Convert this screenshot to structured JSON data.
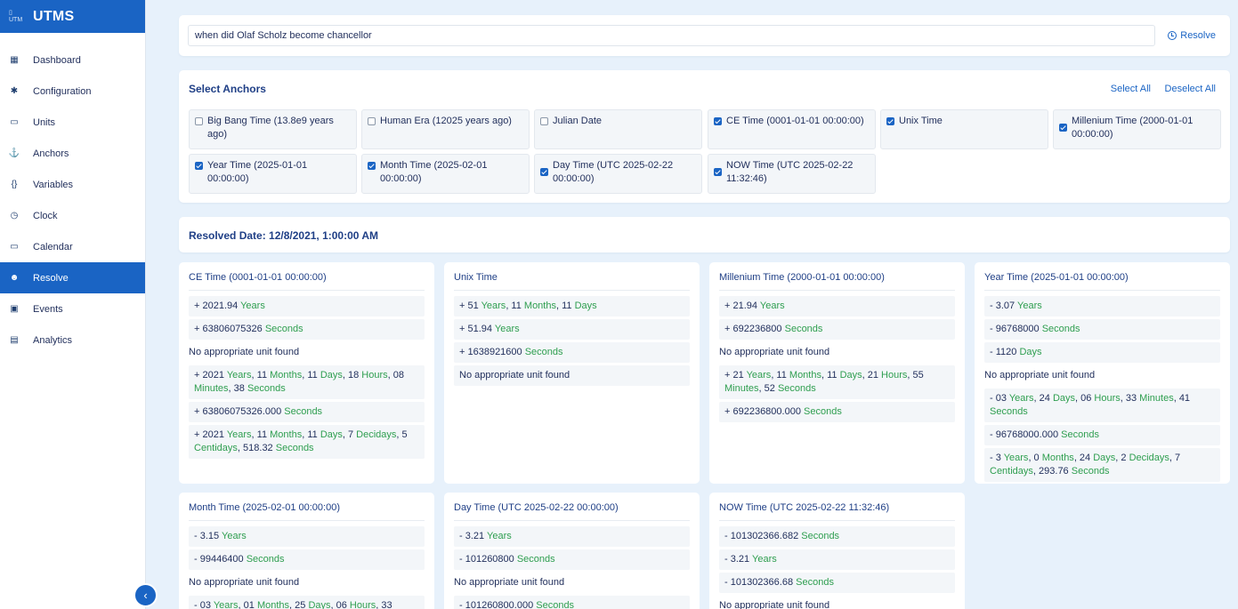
{
  "app": {
    "logo_text": "UTM",
    "title": "UTMS"
  },
  "sidebar": {
    "items": [
      {
        "label": "Dashboard",
        "icon": "dashboard-icon",
        "glyph": "▦",
        "active": false
      },
      {
        "label": "Configuration",
        "icon": "gear-icon",
        "glyph": "✱",
        "active": false
      },
      {
        "label": "Units",
        "icon": "ruler-icon",
        "glyph": "▭",
        "active": false
      },
      {
        "label": "Anchors",
        "icon": "anchor-icon",
        "glyph": "⚓",
        "active": false
      },
      {
        "label": "Variables",
        "icon": "braces-icon",
        "glyph": "{}",
        "active": false
      },
      {
        "label": "Clock",
        "icon": "clock-icon",
        "glyph": "◷",
        "active": false
      },
      {
        "label": "Calendar",
        "icon": "calendar-icon",
        "glyph": "▭",
        "active": false
      },
      {
        "label": "Resolve",
        "icon": "robot-icon",
        "glyph": "☻",
        "active": true
      },
      {
        "label": "Events",
        "icon": "event-icon",
        "glyph": "▣",
        "active": false
      },
      {
        "label": "Analytics",
        "icon": "analytics-icon",
        "glyph": "▤",
        "active": false
      }
    ],
    "collapse_glyph": "‹"
  },
  "search": {
    "value": "when did Olaf Scholz become chancellor",
    "resolve_label": "Resolve"
  },
  "anchors": {
    "title": "Select Anchors",
    "select_all": "Select All",
    "deselect_all": "Deselect All",
    "items": [
      {
        "label": "Big Bang Time (13.8e9 years ago)",
        "checked": false
      },
      {
        "label": "Human Era (12025 years ago)",
        "checked": false
      },
      {
        "label": "Julian Date",
        "checked": false
      },
      {
        "label": "CE Time (0001-01-01 00:00:00)",
        "checked": true
      },
      {
        "label": "Unix Time",
        "checked": true
      },
      {
        "label": "Millenium Time (2000-01-01 00:00:00)",
        "checked": true
      },
      {
        "label": "Year Time (2025-01-01 00:00:00)",
        "checked": true
      },
      {
        "label": "Month Time (2025-02-01 00:00:00)",
        "checked": true
      },
      {
        "label": "Day Time (UTC 2025-02-22 00:00:00)",
        "checked": true
      },
      {
        "label": "NOW Time (UTC 2025-02-22 11:32:46)",
        "checked": true
      }
    ]
  },
  "resolved": {
    "title": "Resolved Date: 12/8/2021, 1:00:00 AM"
  },
  "results": [
    {
      "title": "CE Time (0001-01-01 00:00:00)",
      "rows": [
        [
          [
            "+ 2021.94 ",
            "t"
          ],
          [
            "Years",
            "u"
          ]
        ],
        [
          [
            "+ 63806075326 ",
            "t"
          ],
          [
            "Seconds",
            "u"
          ]
        ],
        [
          [
            "No appropriate unit found",
            "p"
          ]
        ],
        [
          [
            "+ 2021 ",
            "t"
          ],
          [
            "Years",
            "u"
          ],
          [
            ", 11 ",
            "t"
          ],
          [
            "Months",
            "u"
          ],
          [
            ", 11 ",
            "t"
          ],
          [
            "Days",
            "u"
          ],
          [
            ", 18 ",
            "t"
          ],
          [
            "Hours",
            "u"
          ],
          [
            ", 08 ",
            "t"
          ],
          [
            "Minutes",
            "u"
          ],
          [
            ", 38 ",
            "t"
          ],
          [
            "Seconds",
            "u"
          ]
        ],
        [
          [
            "+ 63806075326.000 ",
            "t"
          ],
          [
            "Seconds",
            "u"
          ]
        ],
        [
          [
            "+ 2021 ",
            "t"
          ],
          [
            "Years",
            "u"
          ],
          [
            ", 11 ",
            "t"
          ],
          [
            "Months",
            "u"
          ],
          [
            ", 11 ",
            "t"
          ],
          [
            "Days",
            "u"
          ],
          [
            ", 7 ",
            "t"
          ],
          [
            "Decidays",
            "u"
          ],
          [
            ", 5 ",
            "t"
          ],
          [
            "Centidays",
            "u"
          ],
          [
            ", 518.32 ",
            "t"
          ],
          [
            "Seconds",
            "u"
          ]
        ]
      ]
    },
    {
      "title": "Unix Time",
      "rows": [
        [
          [
            "+ 51 ",
            "t"
          ],
          [
            "Years",
            "u"
          ],
          [
            ", 11 ",
            "t"
          ],
          [
            "Months",
            "u"
          ],
          [
            ", 11 ",
            "t"
          ],
          [
            "Days",
            "u"
          ]
        ],
        [
          [
            "+ 51.94 ",
            "t"
          ],
          [
            "Years",
            "u"
          ]
        ],
        [
          [
            "+ 1638921600 ",
            "t"
          ],
          [
            "Seconds",
            "u"
          ]
        ],
        [
          [
            "No appropriate unit found",
            "t"
          ]
        ]
      ]
    },
    {
      "title": "Millenium Time (2000-01-01 00:00:00)",
      "rows": [
        [
          [
            "+ 21.94 ",
            "t"
          ],
          [
            "Years",
            "u"
          ]
        ],
        [
          [
            "+ 692236800 ",
            "t"
          ],
          [
            "Seconds",
            "u"
          ]
        ],
        [
          [
            "No appropriate unit found",
            "p"
          ]
        ],
        [
          [
            "+ 21 ",
            "t"
          ],
          [
            "Years",
            "u"
          ],
          [
            ", 11 ",
            "t"
          ],
          [
            "Months",
            "u"
          ],
          [
            ", 11 ",
            "t"
          ],
          [
            "Days",
            "u"
          ],
          [
            ", 21 ",
            "t"
          ],
          [
            "Hours",
            "u"
          ],
          [
            ", 55 ",
            "t"
          ],
          [
            "Minutes",
            "u"
          ],
          [
            ", 52 ",
            "t"
          ],
          [
            "Seconds",
            "u"
          ]
        ],
        [
          [
            "+ 692236800.000 ",
            "t"
          ],
          [
            "Seconds",
            "u"
          ]
        ]
      ]
    },
    {
      "title": "Year Time (2025-01-01 00:00:00)",
      "rows": [
        [
          [
            "- 3.07 ",
            "t"
          ],
          [
            "Years",
            "u"
          ]
        ],
        [
          [
            "- 96768000 ",
            "t"
          ],
          [
            "Seconds",
            "u"
          ]
        ],
        [
          [
            "- 1120 ",
            "t"
          ],
          [
            "Days",
            "u"
          ]
        ],
        [
          [
            "No appropriate unit found",
            "p"
          ]
        ],
        [
          [
            "- 03 ",
            "t"
          ],
          [
            "Years",
            "u"
          ],
          [
            ", 24 ",
            "t"
          ],
          [
            "Days",
            "u"
          ],
          [
            ", 06 ",
            "t"
          ],
          [
            "Hours",
            "u"
          ],
          [
            ", 33 ",
            "t"
          ],
          [
            "Minutes",
            "u"
          ],
          [
            ", 41 ",
            "t"
          ],
          [
            "Seconds",
            "u"
          ]
        ],
        [
          [
            "- 96768000.000 ",
            "t"
          ],
          [
            "Seconds",
            "u"
          ]
        ],
        [
          [
            "- 3 ",
            "t"
          ],
          [
            "Years",
            "u"
          ],
          [
            ", 0 ",
            "t"
          ],
          [
            "Months",
            "u"
          ],
          [
            ", 24 ",
            "t"
          ],
          [
            "Days",
            "u"
          ],
          [
            ", 2 ",
            "t"
          ],
          [
            "Decidays",
            "u"
          ],
          [
            ", 7 ",
            "t"
          ],
          [
            "Centidays",
            "u"
          ],
          [
            ", 293.76 ",
            "t"
          ],
          [
            "Seconds",
            "u"
          ]
        ]
      ]
    },
    {
      "title": "Month Time (2025-02-01 00:00:00)",
      "rows": [
        [
          [
            "- 3.15 ",
            "t"
          ],
          [
            "Years",
            "u"
          ]
        ],
        [
          [
            "- 99446400 ",
            "t"
          ],
          [
            "Seconds",
            "u"
          ]
        ],
        [
          [
            "No appropriate unit found",
            "p"
          ]
        ],
        [
          [
            "- 03 ",
            "t"
          ],
          [
            "Years",
            "u"
          ],
          [
            ", 01 ",
            "t"
          ],
          [
            "Months",
            "u"
          ],
          [
            ", 25 ",
            "t"
          ],
          [
            "Days",
            "u"
          ],
          [
            ", 06 ",
            "t"
          ],
          [
            "Hours",
            "u"
          ],
          [
            ", 33",
            "t"
          ]
        ]
      ]
    },
    {
      "title": "Day Time (UTC 2025-02-22 00:00:00)",
      "rows": [
        [
          [
            "- 3.21 ",
            "t"
          ],
          [
            "Years",
            "u"
          ]
        ],
        [
          [
            "- 101260800 ",
            "t"
          ],
          [
            "Seconds",
            "u"
          ]
        ],
        [
          [
            "No appropriate unit found",
            "p"
          ]
        ],
        [
          [
            "- 101260800.000 ",
            "t"
          ],
          [
            "Seconds",
            "u"
          ]
        ]
      ]
    },
    {
      "title": "NOW Time (UTC 2025-02-22 11:32:46)",
      "rows": [
        [
          [
            "- 101302366.682 ",
            "t"
          ],
          [
            "Seconds",
            "u"
          ]
        ],
        [
          [
            "- 3.21 ",
            "t"
          ],
          [
            "Years",
            "u"
          ]
        ],
        [
          [
            "- 101302366.68 ",
            "t"
          ],
          [
            "Seconds",
            "u"
          ]
        ],
        [
          [
            "No appropriate unit found",
            "p"
          ]
        ]
      ]
    }
  ]
}
